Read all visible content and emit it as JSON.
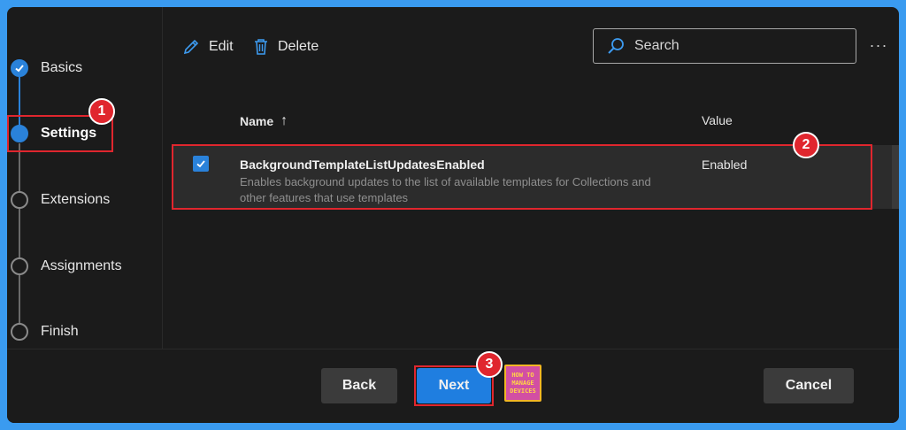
{
  "steps": [
    {
      "label": "Basics",
      "state": "done"
    },
    {
      "label": "Settings",
      "state": "current"
    },
    {
      "label": "Extensions",
      "state": "pending"
    },
    {
      "label": "Assignments",
      "state": "pending"
    },
    {
      "label": "Finish",
      "state": "pending"
    }
  ],
  "toolbar": {
    "edit_label": "Edit",
    "delete_label": "Delete",
    "more": "···"
  },
  "search": {
    "placeholder": "Search"
  },
  "table": {
    "headers": {
      "name": "Name",
      "value": "Value",
      "sort_indicator": "↑"
    },
    "rows": [
      {
        "name": "BackgroundTemplateListUpdatesEnabled",
        "description": "Enables background updates to the list of available templates for Collections and other features that use templates",
        "value": "Enabled",
        "checked": true
      }
    ]
  },
  "footer": {
    "back_label": "Back",
    "next_label": "Next",
    "cancel_label": "Cancel"
  },
  "annotations": {
    "one": "1",
    "two": "2",
    "three": "3"
  },
  "logo": {
    "line1": "HOW TO",
    "line2": "MANAGE",
    "line3": "DEVICES"
  },
  "colors": {
    "accent": "#1f7ee0",
    "highlight": "#e0262e",
    "background": "#1b1b1b",
    "border": "#3a9bf0"
  }
}
